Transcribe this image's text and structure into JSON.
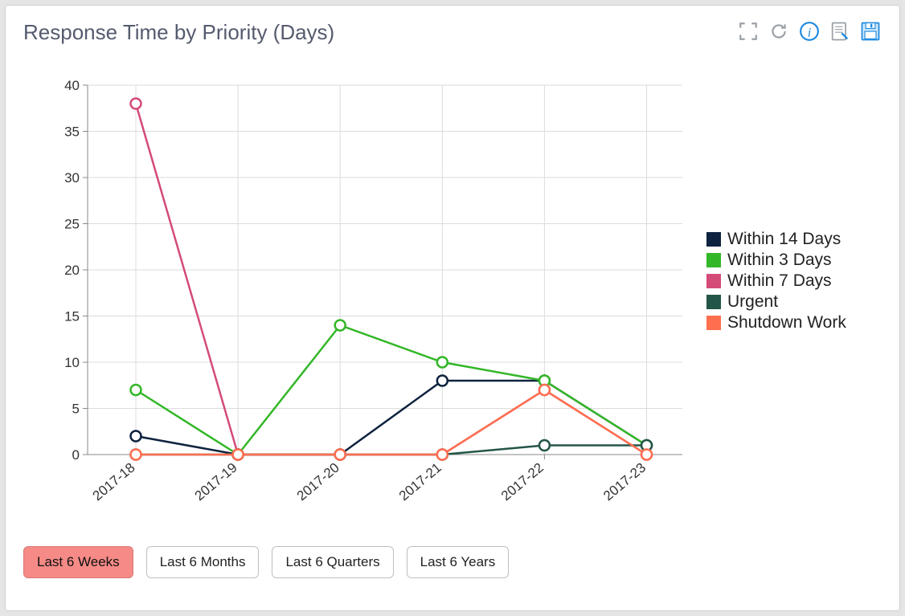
{
  "title": "Response Time by Priority (Days)",
  "toolbar": {
    "fullscreen": "fullscreen",
    "refresh": "refresh",
    "info": "info",
    "edit": "edit",
    "save": "save"
  },
  "chart_data": {
    "type": "line",
    "categories": [
      "2017-18",
      "2017-19",
      "2017-20",
      "2017-21",
      "2017-22",
      "2017-23"
    ],
    "series": [
      {
        "name": "Within 14 Days",
        "color": "#0e233f",
        "values": [
          2,
          0,
          0,
          8,
          8,
          1
        ]
      },
      {
        "name": "Within 3 Days",
        "color": "#33b728",
        "values": [
          7,
          0,
          14,
          10,
          8,
          1
        ]
      },
      {
        "name": "Within 7 Days",
        "color": "#d44b77",
        "values": [
          38,
          0,
          0,
          0,
          7,
          0
        ]
      },
      {
        "name": "Urgent",
        "color": "#235548",
        "values": [
          0,
          0,
          0,
          0,
          1,
          1
        ]
      },
      {
        "name": "Shutdown Work",
        "color": "#ff6e4f",
        "values": [
          0,
          0,
          0,
          0,
          7,
          0
        ]
      }
    ],
    "ylim": [
      0,
      40
    ],
    "yticks": [
      0,
      5,
      10,
      15,
      20,
      25,
      30,
      35,
      40
    ],
    "xlabel": "",
    "ylabel": ""
  },
  "range_buttons": [
    {
      "label": "Last 6 Weeks",
      "active": true
    },
    {
      "label": "Last 6 Months",
      "active": false
    },
    {
      "label": "Last 6 Quarters",
      "active": false
    },
    {
      "label": "Last 6 Years",
      "active": false
    }
  ]
}
